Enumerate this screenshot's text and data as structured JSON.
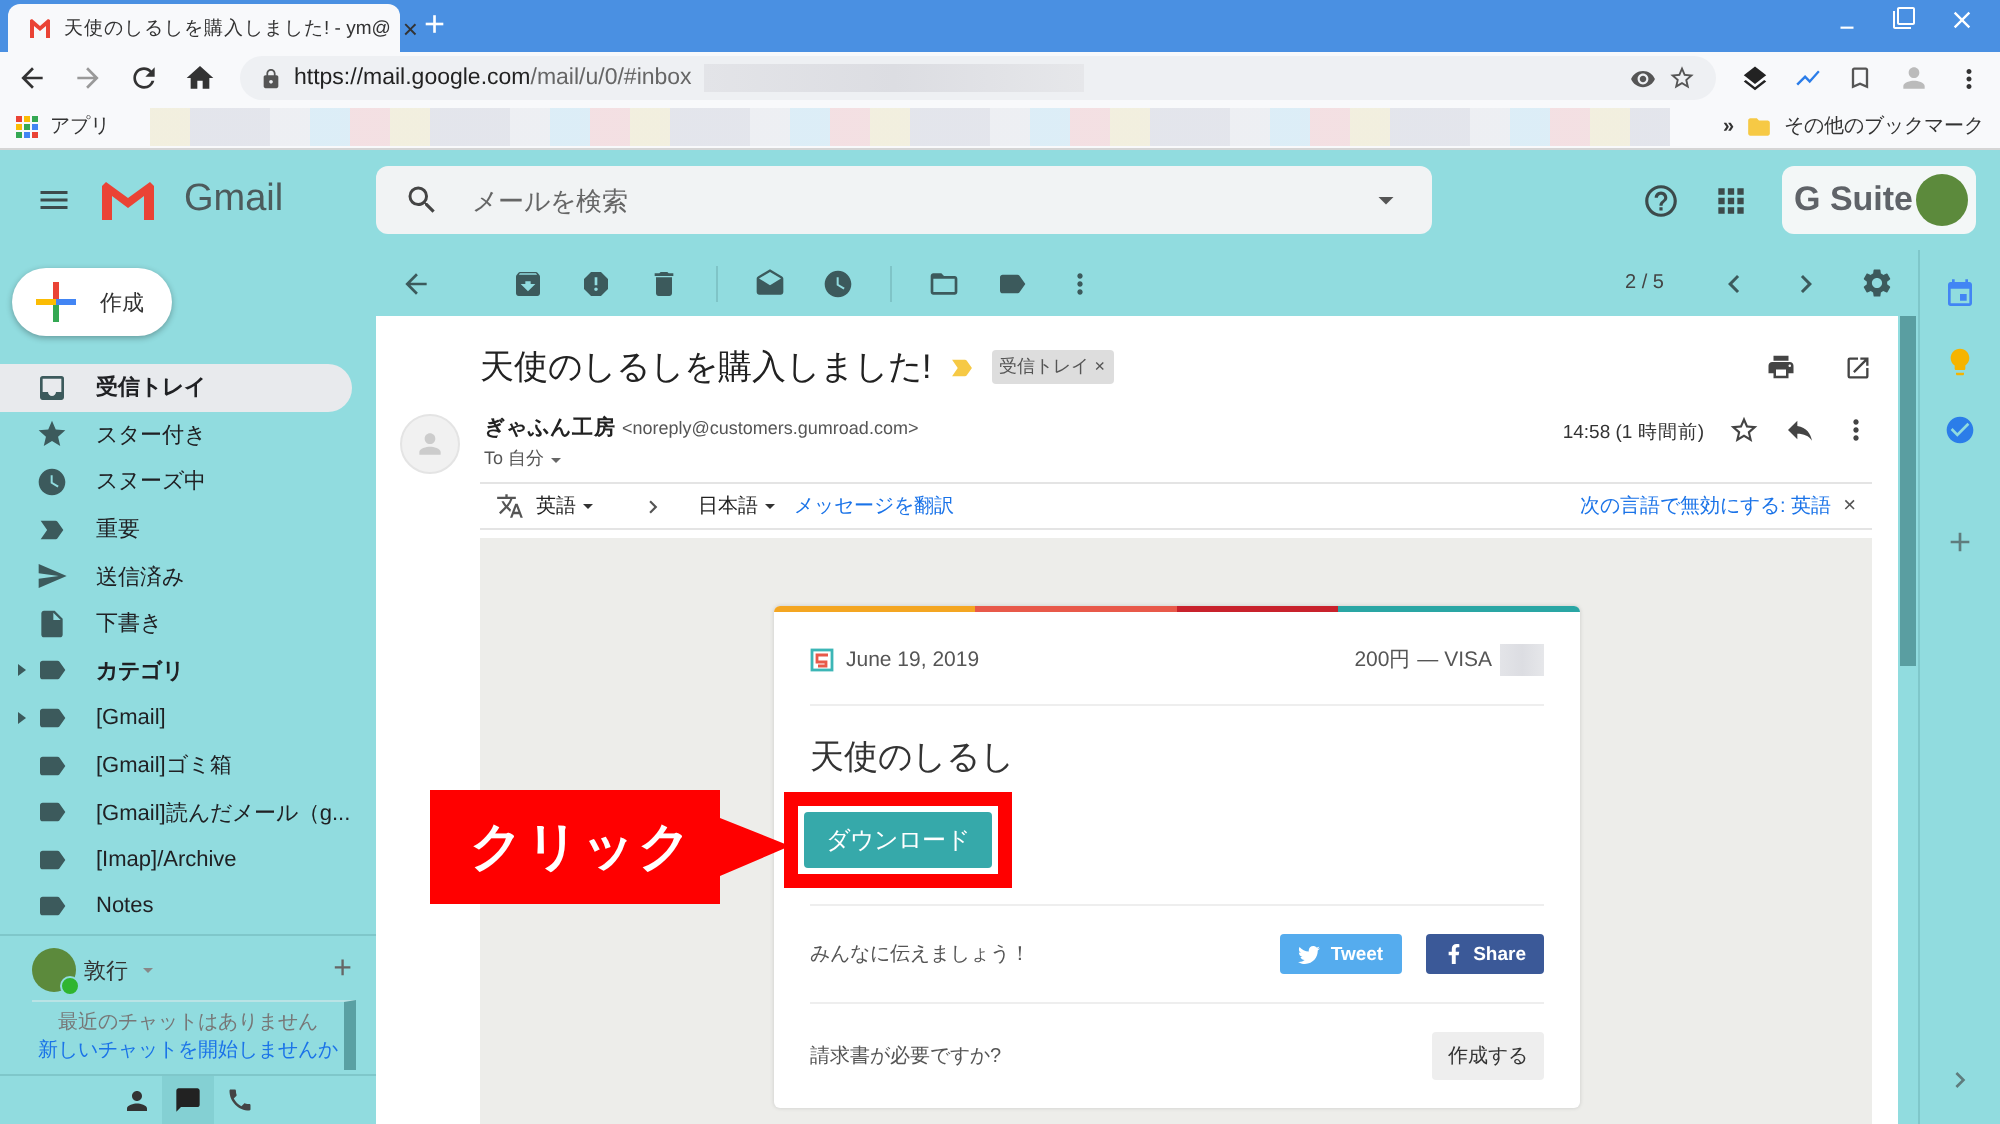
{
  "browser": {
    "tab": {
      "title": "天使のしるしを購入しました! - ym@",
      "close": "×"
    },
    "new_tab": "+",
    "url": {
      "host": "https://mail.google.com",
      "path": "/mail/u/0/#inbox"
    },
    "bookmarks": {
      "apps": "アプリ",
      "more": "»",
      "other": "その他のブックマーク"
    }
  },
  "gmail": {
    "logo": "Gmail",
    "search": {
      "placeholder": "メールを検索"
    },
    "gsuite": "G Suite",
    "compose": "作成",
    "nav": [
      {
        "label": "受信トレイ",
        "kind": "system",
        "selected": true,
        "bold": true
      },
      {
        "label": "スター付き",
        "kind": "system",
        "selected": false,
        "bold": false
      },
      {
        "label": "スヌーズ中",
        "kind": "system",
        "selected": false,
        "bold": false
      },
      {
        "label": "重要",
        "kind": "system",
        "selected": false,
        "bold": false
      },
      {
        "label": "送信済み",
        "kind": "system",
        "selected": false,
        "bold": false
      },
      {
        "label": "下書き",
        "kind": "system",
        "selected": false,
        "bold": false
      },
      {
        "label": "カテゴリ",
        "kind": "group",
        "selected": false,
        "bold": true
      },
      {
        "label": "[Gmail]",
        "kind": "group",
        "selected": false,
        "bold": false
      },
      {
        "label": "[Gmail]ゴミ箱",
        "kind": "label",
        "selected": false,
        "bold": false
      },
      {
        "label": "[Gmail]読んだメール（g...",
        "kind": "label",
        "selected": false,
        "bold": false
      },
      {
        "label": "[Imap]/Archive",
        "kind": "label",
        "selected": false,
        "bold": false
      },
      {
        "label": "Notes",
        "kind": "label",
        "selected": false,
        "bold": false
      }
    ],
    "chat": {
      "user": "敦行",
      "online": true,
      "add": "+",
      "empty": "最近のチャットはありません",
      "start": "新しいチャットを開始しませんか"
    },
    "pager": "2 / 5",
    "mail": {
      "subject": "天使のしるしを購入しました!",
      "label": "受信トレイ",
      "label_close": "×",
      "sender": "ぎゃふん工房",
      "email": "<noreply@customers.gumroad.com>",
      "to": "To 自分",
      "time": "14:58 (1 時間前)",
      "translate": {
        "from": "英語",
        "to": "日本語",
        "action": "メッセージを翻訳",
        "disable": "次の言語で無効にする: 英語",
        "close": "×"
      },
      "receipt": {
        "date": "June 19, 2019",
        "price": "200円 — VISA",
        "product": "天使のしるし",
        "download": "ダウンロード",
        "share_prompt": "みんなに伝えましょう！",
        "tweet": "Tweet",
        "share": "Share",
        "invoice_prompt": "請求書が必要ですか?",
        "invoice_button": "作成する"
      }
    }
  },
  "annotation": {
    "callout": "クリック"
  }
}
